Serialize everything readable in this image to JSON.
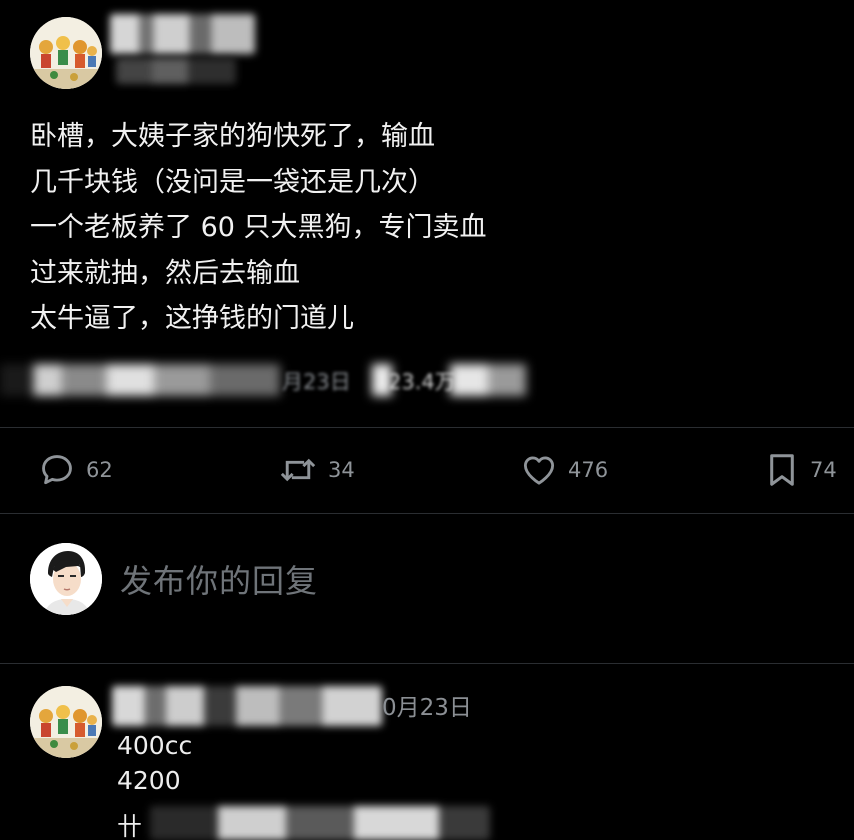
{
  "post": {
    "lines": [
      "卧槽，大姨子家的狗快死了，输血",
      "几千块钱（没问是一袋还是几次）",
      "一个老板养了 60 只大黑狗，专门卖血",
      "过来就抽，然后去输血",
      "太牛逼了，这挣钱的门道儿"
    ],
    "meta_fragments": [
      "月23日",
      "23.4万"
    ],
    "icons": {
      "avatar": "cartoon-kids-avatar"
    }
  },
  "actions": {
    "replies": {
      "icon": "comment-icon",
      "count": "62"
    },
    "reposts": {
      "icon": "repost-icon",
      "count": "34"
    },
    "likes": {
      "icon": "heart-icon",
      "count": "476"
    },
    "bookmarks": {
      "icon": "bookmark-icon",
      "count": "74"
    }
  },
  "composer": {
    "placeholder": "发布你的回复",
    "avatar": "cartoon-man-avatar"
  },
  "reply": {
    "date": "0月23日",
    "lines": [
      "400cc",
      "4200"
    ],
    "truncated_char": "卄"
  },
  "colors": {
    "background": "#000000",
    "text": "#e7e9ea",
    "muted": "#8f9499",
    "divider": "#2a2d31"
  }
}
